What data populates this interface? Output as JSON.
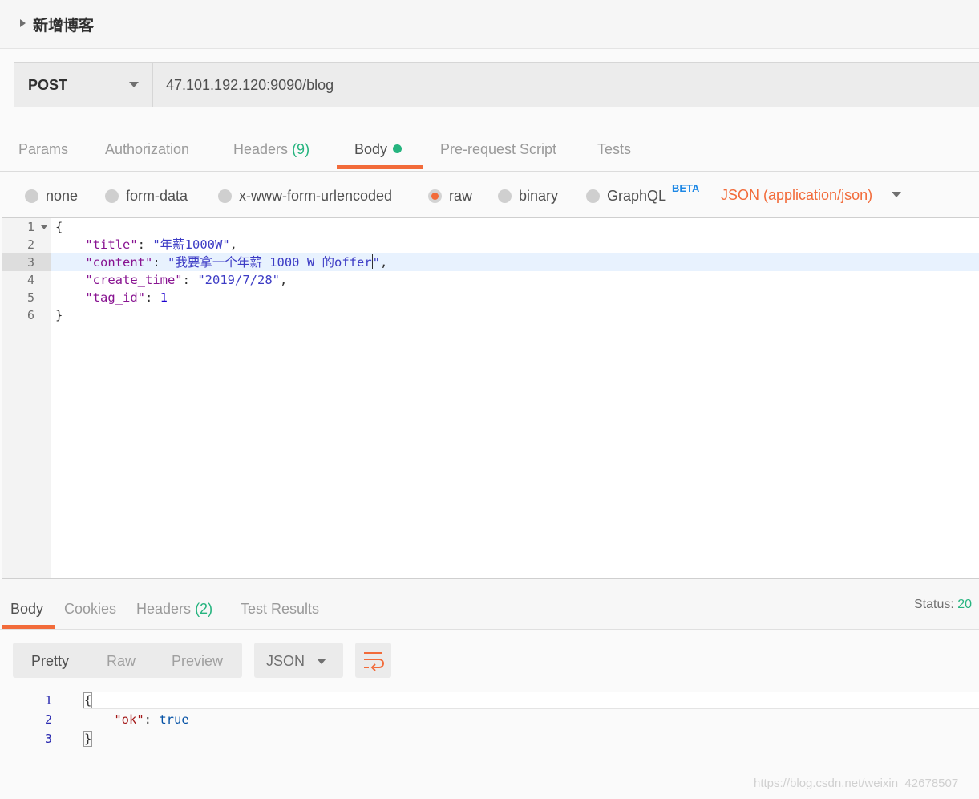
{
  "request": {
    "title": "新增博客",
    "method": "POST",
    "url": "47.101.192.120:9090/blog"
  },
  "request_tabs": {
    "params": "Params",
    "authorization": "Authorization",
    "headers": "Headers",
    "headers_count": "(9)",
    "body": "Body",
    "pre_request": "Pre-request Script",
    "tests": "Tests"
  },
  "body_types": {
    "none": "none",
    "form_data": "form-data",
    "urlencoded": "x-www-form-urlencoded",
    "raw": "raw",
    "binary": "binary",
    "graphql": "GraphQL",
    "beta": "BETA",
    "content_type": "JSON (application/json)",
    "selected": "raw"
  },
  "editor": {
    "line_numbers": [
      "1",
      "2",
      "3",
      "4",
      "5",
      "6"
    ],
    "open_brace": "{",
    "close_brace": "}",
    "title_key": "\"title\"",
    "title_value": "\"年薪1000W\"",
    "content_key": "\"content\"",
    "content_value_a": "\"我要拿一个年薪 1000 W 的offer",
    "content_value_b": "\"",
    "create_time_key": "\"create_time\"",
    "create_time_value": "\"2019/7/28\"",
    "tag_id_key": "\"tag_id\"",
    "tag_id_value": "1",
    "colon": ": ",
    "comma": ","
  },
  "response_tabs": {
    "body": "Body",
    "cookies": "Cookies",
    "headers": "Headers",
    "headers_count": "(2)",
    "test_results": "Test Results",
    "status_label": "Status:",
    "status_value": "20"
  },
  "response_toolbar": {
    "pretty": "Pretty",
    "raw": "Raw",
    "preview": "Preview",
    "format": "JSON"
  },
  "response_body": {
    "line_numbers": [
      "1",
      "2",
      "3"
    ],
    "open_brace": "{",
    "close_brace": "}",
    "ok_key": "\"ok\"",
    "colon": ": ",
    "ok_value": "true"
  },
  "watermark": "https://blog.csdn.net/weixin_42678507",
  "colors": {
    "accent": "#f26b3a",
    "count_green": "#26b47f",
    "beta_blue": "#1e88e5"
  }
}
